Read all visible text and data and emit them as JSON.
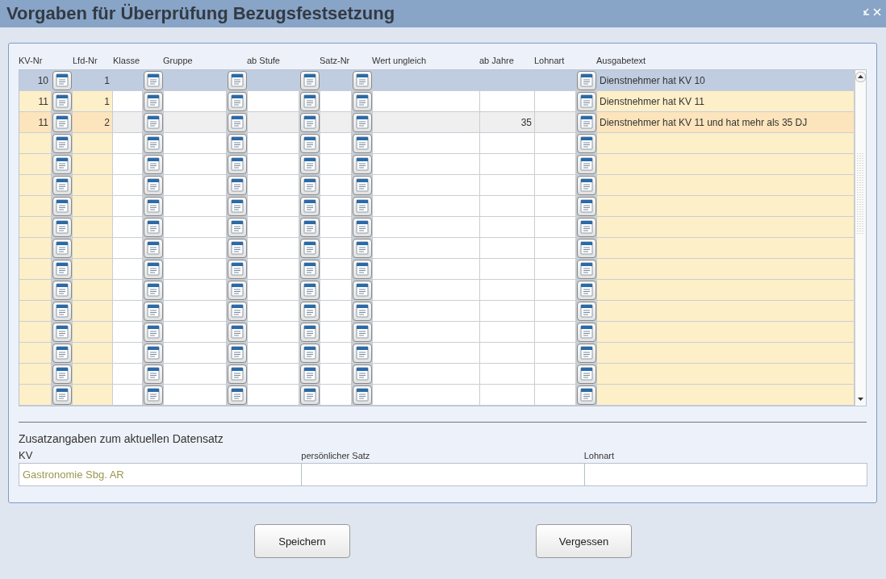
{
  "window": {
    "title": "Vorgaben für Überprüfung Bezugsfestsetzung"
  },
  "table": {
    "columns": [
      "KV-Nr",
      "Lfd-Nr",
      "Klasse",
      "Gruppe",
      "ab Stufe",
      "Satz-Nr",
      "Wert ungleich",
      "ab Jahre",
      "Lohnart",
      "Ausgabetext"
    ],
    "rows": [
      {
        "selected": true,
        "hovered": false,
        "kv_nr": "10",
        "lfd_nr": "1",
        "ausgabetext": "Dienstnehmer hat KV 10"
      },
      {
        "selected": false,
        "hovered": false,
        "kv_nr": "11",
        "lfd_nr": "1",
        "ausgabetext": "Dienstnehmer hat KV 11"
      },
      {
        "selected": false,
        "hovered": true,
        "kv_nr": "11",
        "lfd_nr": "2",
        "ab_jahre": "35",
        "ausgabetext": "Dienstnehmer hat KV 11 und hat mehr als 35 DJ"
      },
      {
        "selected": false,
        "hovered": false
      },
      {
        "selected": false,
        "hovered": false
      },
      {
        "selected": false,
        "hovered": false
      },
      {
        "selected": false,
        "hovered": false
      },
      {
        "selected": false,
        "hovered": false
      },
      {
        "selected": false,
        "hovered": false
      },
      {
        "selected": false,
        "hovered": false
      },
      {
        "selected": false,
        "hovered": false
      },
      {
        "selected": false,
        "hovered": false
      },
      {
        "selected": false,
        "hovered": false
      },
      {
        "selected": false,
        "hovered": false
      },
      {
        "selected": false,
        "hovered": false
      },
      {
        "selected": false,
        "hovered": false
      }
    ]
  },
  "details": {
    "title": "Zusatzangaben zum aktuellen Datensatz",
    "fields": [
      {
        "label": "KV",
        "value": "Gastronomie Sbg. AR"
      },
      {
        "label": "persönlicher Satz"
      },
      {
        "label": "Lohnart"
      }
    ]
  },
  "buttons": [
    "Speichern",
    "Vergessen"
  ]
}
